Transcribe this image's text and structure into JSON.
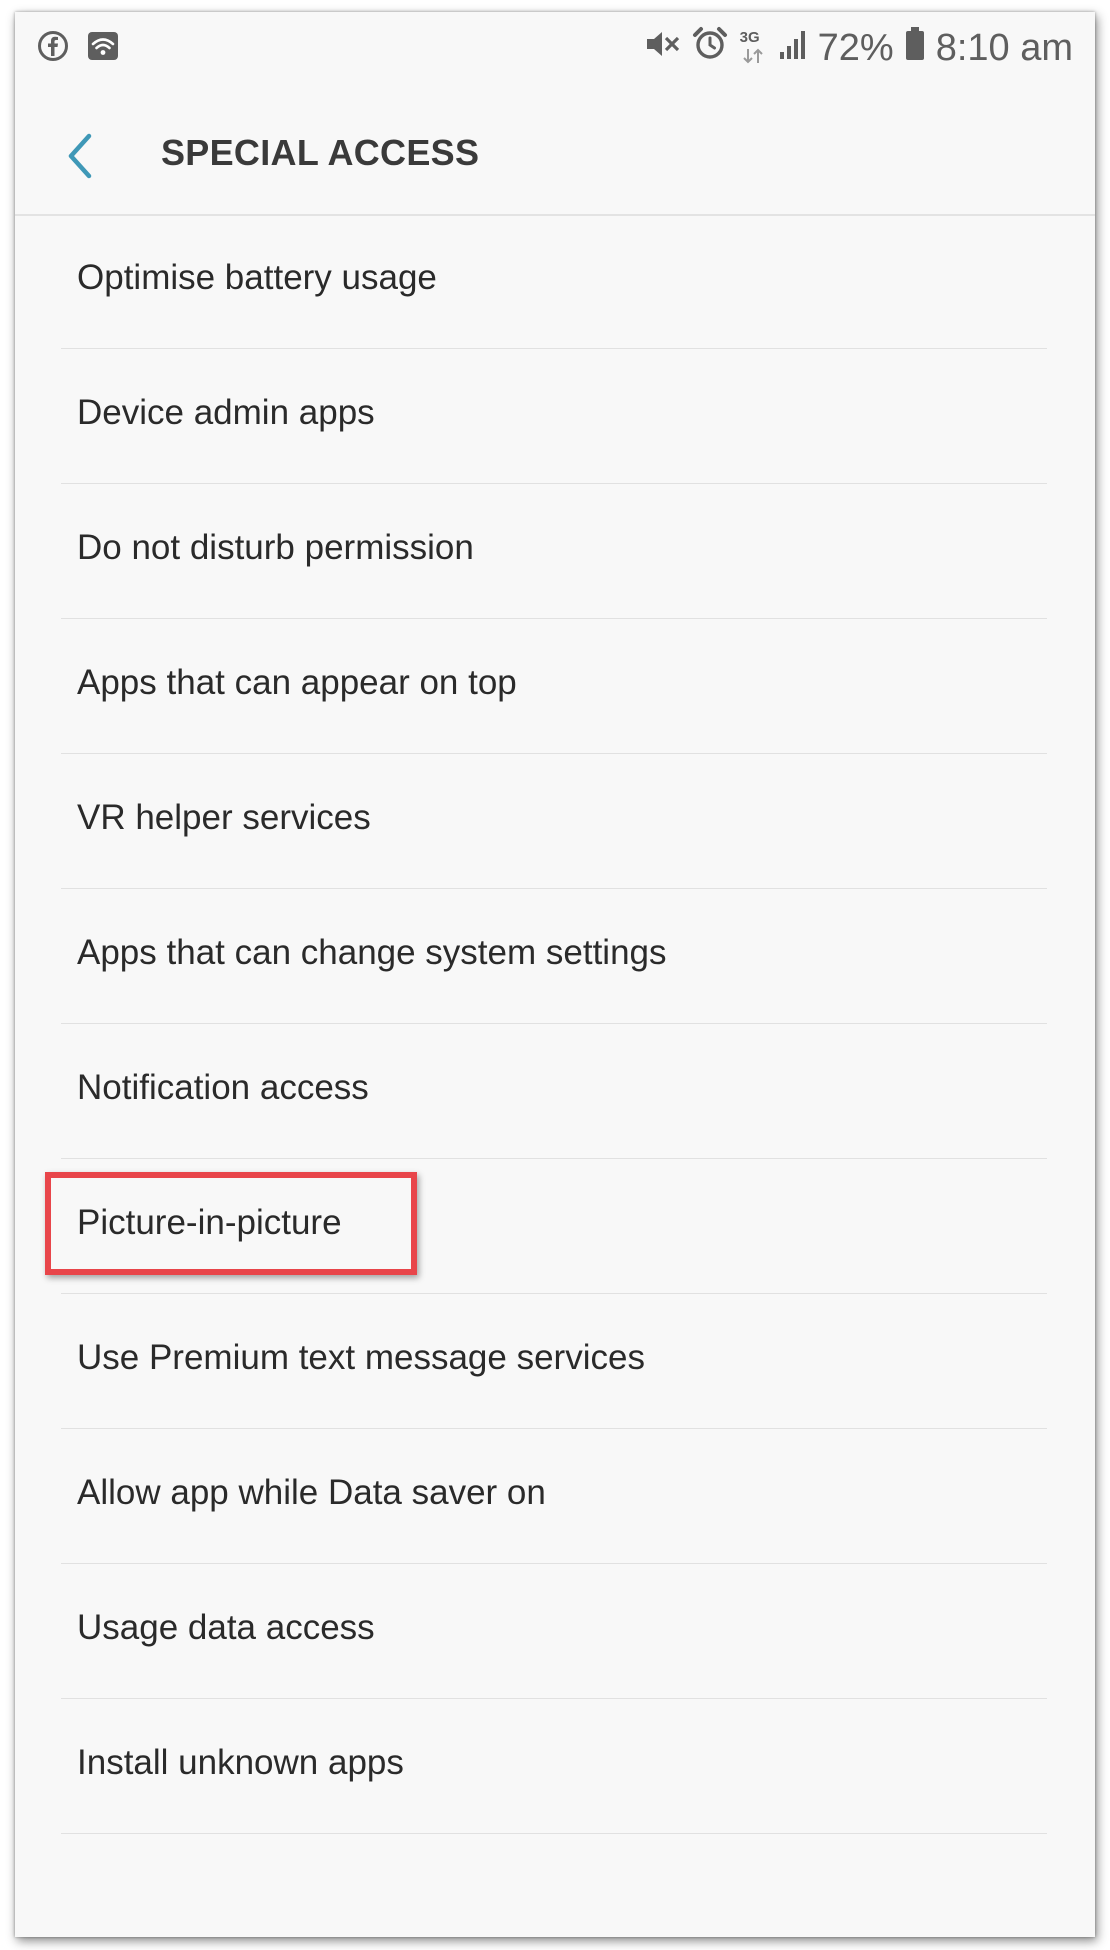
{
  "status_bar": {
    "left_icons": [
      "facebook-icon",
      "wifi-icon"
    ],
    "right_icons": [
      "vibrate-mute-icon",
      "alarm-icon",
      "network-3g-icon",
      "signal-icon",
      "battery-icon"
    ],
    "network_label": "3G",
    "battery_percent": "72%",
    "time": "8:10 am"
  },
  "header": {
    "back_icon": "chevron-left-icon",
    "title": "SPECIAL ACCESS",
    "accent_color": "#3f98b7"
  },
  "list": {
    "items": [
      {
        "label": "Optimise battery usage"
      },
      {
        "label": "Device admin apps"
      },
      {
        "label": "Do not disturb permission"
      },
      {
        "label": "Apps that can appear on top"
      },
      {
        "label": "VR helper services"
      },
      {
        "label": "Apps that can change system settings"
      },
      {
        "label": "Notification access"
      },
      {
        "label": "Picture-in-picture"
      },
      {
        "label": "Use Premium text message services"
      },
      {
        "label": "Allow app while Data saver on"
      },
      {
        "label": "Usage data access"
      },
      {
        "label": "Install unknown apps"
      }
    ]
  },
  "annotation": {
    "highlighted_item": "Picture-in-picture",
    "color": "#e8454a"
  }
}
